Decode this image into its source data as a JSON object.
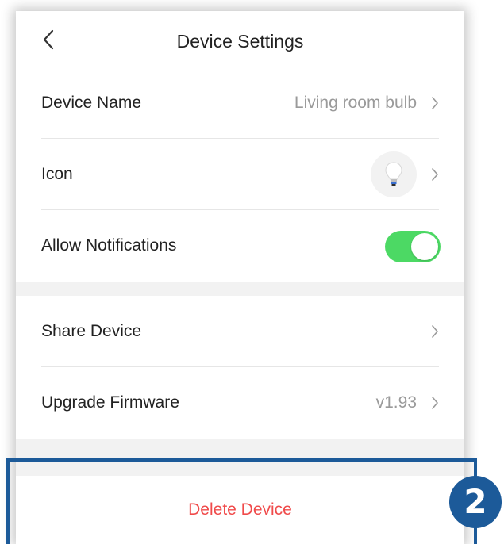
{
  "header": {
    "title": "Device Settings",
    "back_icon": "chevron-left-icon"
  },
  "group1": {
    "device_name": {
      "label": "Device Name",
      "value": "Living room bulb"
    },
    "icon_row": {
      "label": "Icon",
      "icon": "light-bulb-icon"
    },
    "notifications": {
      "label": "Allow Notifications",
      "enabled": true
    }
  },
  "group2": {
    "share": {
      "label": "Share Device"
    },
    "firmware": {
      "label": "Upgrade Firmware",
      "value": "v1.93"
    }
  },
  "delete": {
    "label": "Delete Device"
  },
  "annotation": {
    "badge": "2"
  },
  "colors": {
    "toggle_on": "#4cd964",
    "delete_text": "#f04b4b",
    "highlight_border": "#1c5a99",
    "badge_bg": "#1c5a99"
  }
}
